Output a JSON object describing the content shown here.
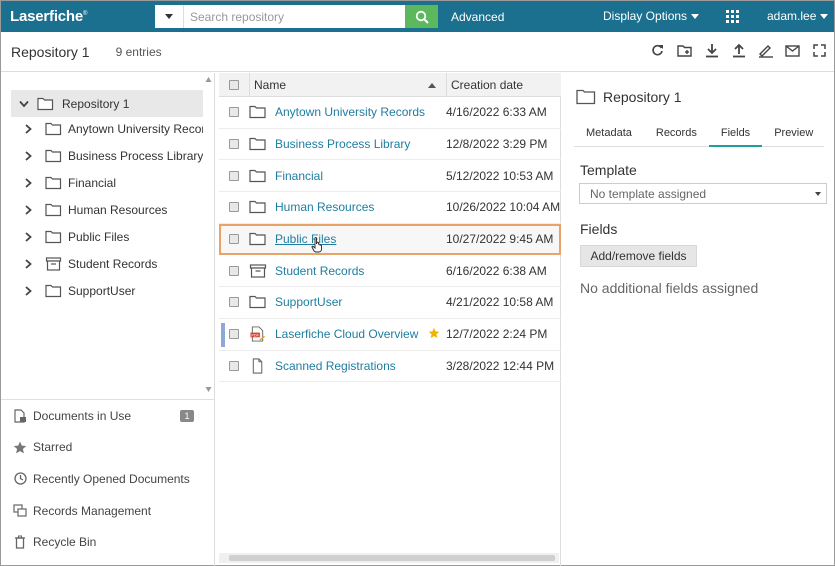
{
  "app": {
    "logo": "Laserfiche",
    "logo_mark": "®"
  },
  "topbar": {
    "search_placeholder": "Search repository",
    "advanced": "Advanced",
    "display_options": "Display Options",
    "user": "adam.lee"
  },
  "titlebar": {
    "title": "Repository 1",
    "entries": "9 entries"
  },
  "tree": {
    "root": "Repository 1",
    "items": [
      {
        "label": "Anytown University Records",
        "icon": "folder-icon"
      },
      {
        "label": "Business Process Library",
        "icon": "folder-icon"
      },
      {
        "label": "Financial",
        "icon": "folder-icon"
      },
      {
        "label": "Human Resources",
        "icon": "folder-icon"
      },
      {
        "label": "Public Files",
        "icon": "folder-icon"
      },
      {
        "label": "Student Records",
        "icon": "records-folder-icon"
      },
      {
        "label": "SupportUser",
        "icon": "folder-icon"
      }
    ]
  },
  "nav": {
    "items": [
      {
        "label": "Documents in Use",
        "badge": "1"
      },
      {
        "label": "Starred"
      },
      {
        "label": "Recently Opened Documents"
      },
      {
        "label": "Records Management"
      },
      {
        "label": "Recycle Bin"
      }
    ]
  },
  "list": {
    "headers": {
      "name": "Name",
      "date": "Creation date"
    },
    "rows": [
      {
        "name": "Anytown University Records",
        "date": "4/16/2022 6:33 AM",
        "icon": "folder-icon"
      },
      {
        "name": "Business Process Library",
        "date": "12/8/2022 3:29 PM",
        "icon": "folder-icon"
      },
      {
        "name": "Financial",
        "date": "5/12/2022 10:53 AM",
        "icon": "folder-icon"
      },
      {
        "name": "Human Resources",
        "date": "10/26/2022 10:04 AM",
        "icon": "folder-icon"
      },
      {
        "name": "Public Files",
        "date": "10/27/2022 9:45 AM",
        "icon": "folder-icon"
      },
      {
        "name": "Student Records",
        "date": "6/16/2022 6:38 AM",
        "icon": "records-folder-icon"
      },
      {
        "name": "SupportUser",
        "date": "4/21/2022 10:58 AM",
        "icon": "folder-icon"
      },
      {
        "name": "Laserfiche Cloud Overview",
        "date": "12/7/2022 2:24 PM",
        "icon": "pdf-icon"
      },
      {
        "name": "Scanned Registrations",
        "date": "3/28/2022 12:44 PM",
        "icon": "document-icon"
      }
    ]
  },
  "details": {
    "title": "Repository 1",
    "tabs": [
      "Metadata",
      "Records",
      "Fields",
      "Preview"
    ],
    "template_label": "Template",
    "template_value": "No template assigned",
    "fields_label": "Fields",
    "add_fields_button": "Add/remove fields",
    "no_fields": "No additional fields assigned"
  },
  "colors": {
    "topbar": "#1b6f8f",
    "link": "#1e7ea1",
    "search_button": "#5cb85c",
    "highlight": "#e8a466",
    "tab_active": "#1e9e9e",
    "star": "#f0b400"
  }
}
